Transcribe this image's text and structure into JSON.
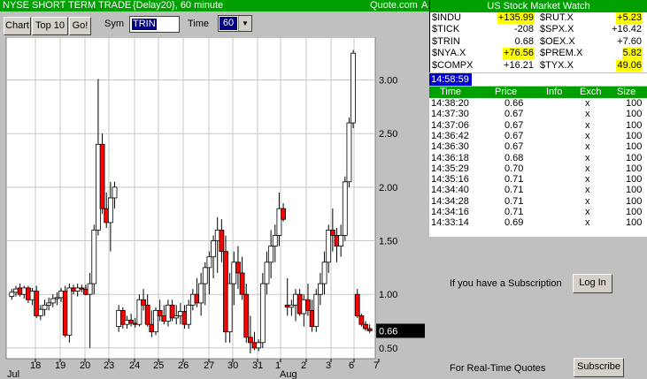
{
  "left_panel": {
    "title": "NYSE SHORT TERM TRADE",
    "subtitle": "{Delay20}, 60 minute",
    "source": "Quote.com",
    "corner_label": "A",
    "buttons": {
      "chart": "Chart",
      "top10": "Top 10",
      "go": "Go!"
    },
    "sym_label": "Sym",
    "sym_value": "TRIN",
    "time_label": "Time",
    "time_value": "60",
    "dropdown_arrow": "chevron-down-icon"
  },
  "chart_data": {
    "type": "candlestick",
    "symbol": "TRIN",
    "interval": "60 minute",
    "ylim": [
      0.4,
      3.4
    ],
    "yticks": [
      "3.00",
      "2.50",
      "2.00",
      "1.50",
      "1.00",
      "0.50"
    ],
    "ytick_values": [
      3.0,
      2.5,
      2.0,
      1.5,
      1.0,
      0.5
    ],
    "x_tick_labels": [
      "18",
      "19",
      "20",
      "23",
      "24",
      "25",
      "26",
      "27",
      "30",
      "31",
      "1",
      "2",
      "3",
      "6",
      "7"
    ],
    "month_labels": [
      "Jul",
      "Aug"
    ],
    "last_value": "0.66",
    "up_color": "#ffffff",
    "down_color": "#ff0000",
    "candles": [
      [
        0.98,
        1.05,
        0.95,
        1.02
      ],
      [
        1.02,
        1.08,
        0.98,
        1.05
      ],
      [
        1.06,
        1.1,
        0.98,
        1.0
      ],
      [
        1.0,
        1.08,
        0.96,
        1.06
      ],
      [
        1.06,
        1.08,
        0.92,
        0.95
      ],
      [
        0.95,
        1.06,
        0.9,
        1.03
      ],
      [
        1.03,
        1.08,
        0.78,
        0.8
      ],
      [
        0.8,
        0.9,
        0.76,
        0.86
      ],
      [
        0.86,
        0.95,
        0.8,
        0.9
      ],
      [
        0.9,
        0.97,
        0.85,
        0.92
      ],
      [
        0.92,
        1.0,
        0.88,
        0.96
      ],
      [
        0.96,
        1.02,
        0.9,
        0.97
      ],
      [
        0.97,
        1.06,
        0.93,
        1.03
      ],
      [
        1.03,
        1.08,
        0.6,
        0.62
      ],
      [
        0.62,
        1.1,
        0.55,
        1.06
      ],
      [
        1.06,
        1.09,
        1.0,
        1.03
      ],
      [
        1.03,
        1.1,
        0.98,
        1.06
      ],
      [
        1.06,
        1.09,
        1.02,
        1.05
      ],
      [
        1.05,
        1.09,
        0.99,
        1.0
      ],
      [
        1.0,
        1.2,
        0.5,
        1.1
      ],
      [
        1.1,
        1.65,
        1.0,
        1.6
      ],
      [
        1.6,
        3.01,
        1.55,
        2.4
      ],
      [
        2.4,
        2.5,
        1.75,
        1.8
      ],
      [
        1.8,
        1.95,
        1.62,
        1.67
      ],
      [
        1.67,
        2.05,
        1.4,
        1.9
      ],
      [
        1.9,
        2.05,
        1.8,
        2.0
      ],
      [
        0.7,
        0.9,
        0.65,
        0.85
      ],
      [
        0.85,
        0.88,
        0.68,
        0.72
      ],
      [
        0.72,
        0.8,
        0.68,
        0.76
      ],
      [
        0.76,
        0.82,
        0.7,
        0.73
      ],
      [
        0.73,
        0.78,
        0.69,
        0.72
      ],
      [
        0.72,
        1.0,
        0.7,
        0.95
      ],
      [
        0.95,
        1.05,
        0.85,
        0.9
      ],
      [
        0.9,
        1.0,
        0.7,
        0.72
      ],
      [
        0.72,
        0.85,
        0.6,
        0.65
      ],
      [
        0.65,
        0.88,
        0.62,
        0.85
      ],
      [
        0.85,
        0.95,
        0.75,
        0.8
      ],
      [
        0.8,
        0.9,
        0.72,
        0.75
      ],
      [
        0.75,
        0.95,
        0.7,
        0.9
      ],
      [
        0.9,
        0.95,
        0.75,
        0.78
      ],
      [
        0.78,
        0.9,
        0.72,
        0.8
      ],
      [
        0.8,
        0.92,
        0.72,
        0.84
      ],
      [
        0.84,
        0.9,
        0.68,
        0.72
      ],
      [
        0.72,
        0.95,
        0.68,
        0.9
      ],
      [
        0.9,
        1.05,
        0.85,
        1.0
      ],
      [
        1.0,
        1.15,
        0.88,
        0.92
      ],
      [
        0.92,
        1.2,
        0.8,
        1.1
      ],
      [
        1.1,
        1.3,
        0.9,
        1.25
      ],
      [
        1.25,
        1.4,
        1.0,
        1.35
      ],
      [
        1.35,
        1.55,
        1.15,
        1.5
      ],
      [
        1.5,
        1.72,
        1.2,
        1.6
      ],
      [
        1.6,
        1.7,
        1.3,
        1.4
      ],
      [
        1.4,
        1.55,
        0.55,
        0.65
      ],
      [
        0.65,
        1.2,
        0.55,
        1.1
      ],
      [
        1.1,
        1.4,
        0.9,
        1.3
      ],
      [
        1.3,
        1.45,
        1.05,
        1.2
      ],
      [
        1.2,
        1.35,
        0.95,
        1.0
      ],
      [
        1.0,
        1.1,
        0.55,
        0.6
      ],
      [
        0.6,
        0.8,
        0.45,
        0.55
      ],
      [
        0.55,
        0.65,
        0.48,
        0.5
      ],
      [
        0.5,
        0.58,
        0.47,
        0.55
      ],
      [
        0.55,
        1.2,
        0.5,
        1.1
      ],
      [
        1.1,
        1.4,
        1.0,
        1.3
      ],
      [
        1.3,
        1.6,
        1.15,
        1.45
      ],
      [
        1.45,
        1.65,
        1.3,
        1.55
      ],
      [
        1.55,
        1.95,
        1.45,
        1.8
      ],
      [
        1.8,
        1.85,
        1.68,
        1.7
      ],
      [
        0.9,
        1.15,
        0.8,
        0.88
      ],
      [
        0.88,
        0.95,
        0.8,
        0.9
      ],
      [
        0.9,
        1.05,
        0.75,
        1.0
      ],
      [
        1.0,
        1.05,
        0.8,
        0.82
      ],
      [
        0.82,
        1.0,
        0.7,
        0.95
      ],
      [
        0.95,
        1.1,
        0.8,
        0.85
      ],
      [
        0.85,
        0.95,
        0.65,
        0.7
      ],
      [
        0.7,
        1.05,
        0.65,
        1.0
      ],
      [
        1.0,
        1.2,
        0.9,
        1.1
      ],
      [
        1.1,
        1.4,
        1.0,
        1.3
      ],
      [
        1.3,
        1.65,
        1.2,
        1.6
      ],
      [
        1.6,
        1.8,
        1.4,
        1.55
      ],
      [
        1.55,
        1.62,
        1.3,
        1.45
      ],
      [
        1.45,
        1.65,
        1.35,
        1.55
      ],
      [
        1.55,
        2.1,
        1.5,
        2.05
      ],
      [
        2.05,
        2.65,
        2.0,
        2.6
      ],
      [
        2.6,
        3.28,
        2.55,
        3.25
      ],
      [
        1.0,
        1.05,
        0.78,
        0.8
      ],
      [
        0.8,
        0.82,
        0.7,
        0.72
      ],
      [
        0.72,
        0.75,
        0.66,
        0.68
      ],
      [
        0.68,
        0.72,
        0.64,
        0.66
      ]
    ]
  },
  "right_panel": {
    "header": "US Stock Market Watch",
    "watch": [
      {
        "sym": "$INDU",
        "value": "+135.99",
        "highlight": true
      },
      {
        "sym": "$RUT.X",
        "value": "+5.23",
        "highlight": true
      },
      {
        "sym": "$TICK",
        "value": "-208",
        "highlight": false
      },
      {
        "sym": "$SPX.X",
        "value": "+16.42",
        "highlight": false
      },
      {
        "sym": "$TRIN",
        "value": "0.68",
        "highlight": false
      },
      {
        "sym": "$OEX.X",
        "value": "+7.60",
        "highlight": false
      },
      {
        "sym": "$NYA.X",
        "value": "+76.56",
        "highlight": true
      },
      {
        "sym": "$PREM.X",
        "value": "5.82",
        "highlight": true
      },
      {
        "sym": "$COMPX",
        "value": "+16.21",
        "highlight": false
      },
      {
        "sym": "$TYX.X",
        "value": "49.06",
        "highlight": true
      }
    ],
    "clock": "14:58:59",
    "trades_columns": [
      "Time",
      "Price",
      "Info",
      "Exch",
      "Size"
    ],
    "trades": [
      [
        "14:38:20",
        "0.66",
        "",
        "x",
        "100"
      ],
      [
        "14:37:30",
        "0.67",
        "",
        "x",
        "100"
      ],
      [
        "14:37:06",
        "0.67",
        "",
        "x",
        "100"
      ],
      [
        "14:36:42",
        "0.67",
        "",
        "x",
        "100"
      ],
      [
        "14:36:30",
        "0.67",
        "",
        "x",
        "100"
      ],
      [
        "14:36:18",
        "0.68",
        "",
        "x",
        "100"
      ],
      [
        "14:35:29",
        "0.70",
        "",
        "x",
        "100"
      ],
      [
        "14:35:16",
        "0.71",
        "",
        "x",
        "100"
      ],
      [
        "14:34:40",
        "0.71",
        "",
        "x",
        "100"
      ],
      [
        "14:34:28",
        "0.71",
        "",
        "x",
        "100"
      ],
      [
        "14:34:16",
        "0.71",
        "",
        "x",
        "100"
      ],
      [
        "14:33:14",
        "0.69",
        "",
        "x",
        "100"
      ]
    ],
    "subscription_text": "If you have a Subscription",
    "login_label": "Log In",
    "realtime_text": "For Real-Time Quotes",
    "subscribe_label": "Subscribe"
  }
}
